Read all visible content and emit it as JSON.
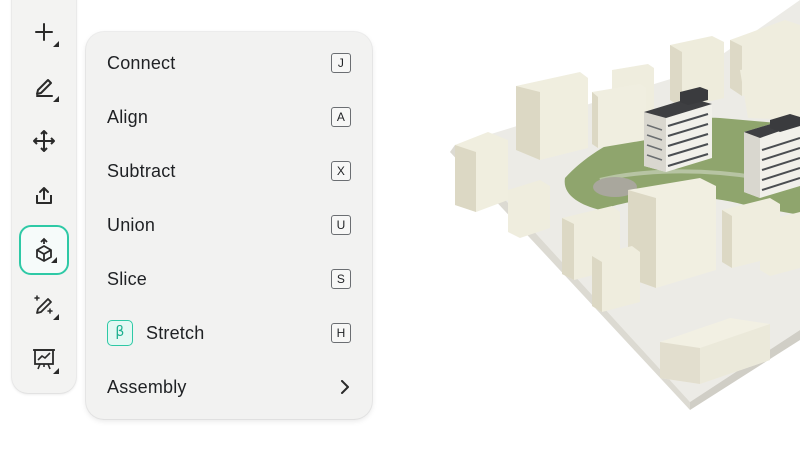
{
  "toolbar": {
    "tools": [
      {
        "icon": "plus-icon"
      },
      {
        "icon": "pencil-icon"
      },
      {
        "icon": "move-arrows-icon"
      },
      {
        "icon": "export-icon"
      },
      {
        "icon": "cube-edit-icon",
        "active": true
      },
      {
        "icon": "magic-wand-icon"
      },
      {
        "icon": "presentation-chart-icon"
      }
    ],
    "accent_color": "#2ec9a6"
  },
  "menu": {
    "items": [
      {
        "label": "Connect",
        "shortcut": "J"
      },
      {
        "label": "Align",
        "shortcut": "A"
      },
      {
        "label": "Subtract",
        "shortcut": "X"
      },
      {
        "label": "Union",
        "shortcut": "U"
      },
      {
        "label": "Slice",
        "shortcut": "S"
      },
      {
        "label": "Stretch",
        "shortcut": "H",
        "badge": "β"
      },
      {
        "label": "Assembly",
        "submenu_icon": "chevron-right-icon"
      }
    ]
  }
}
